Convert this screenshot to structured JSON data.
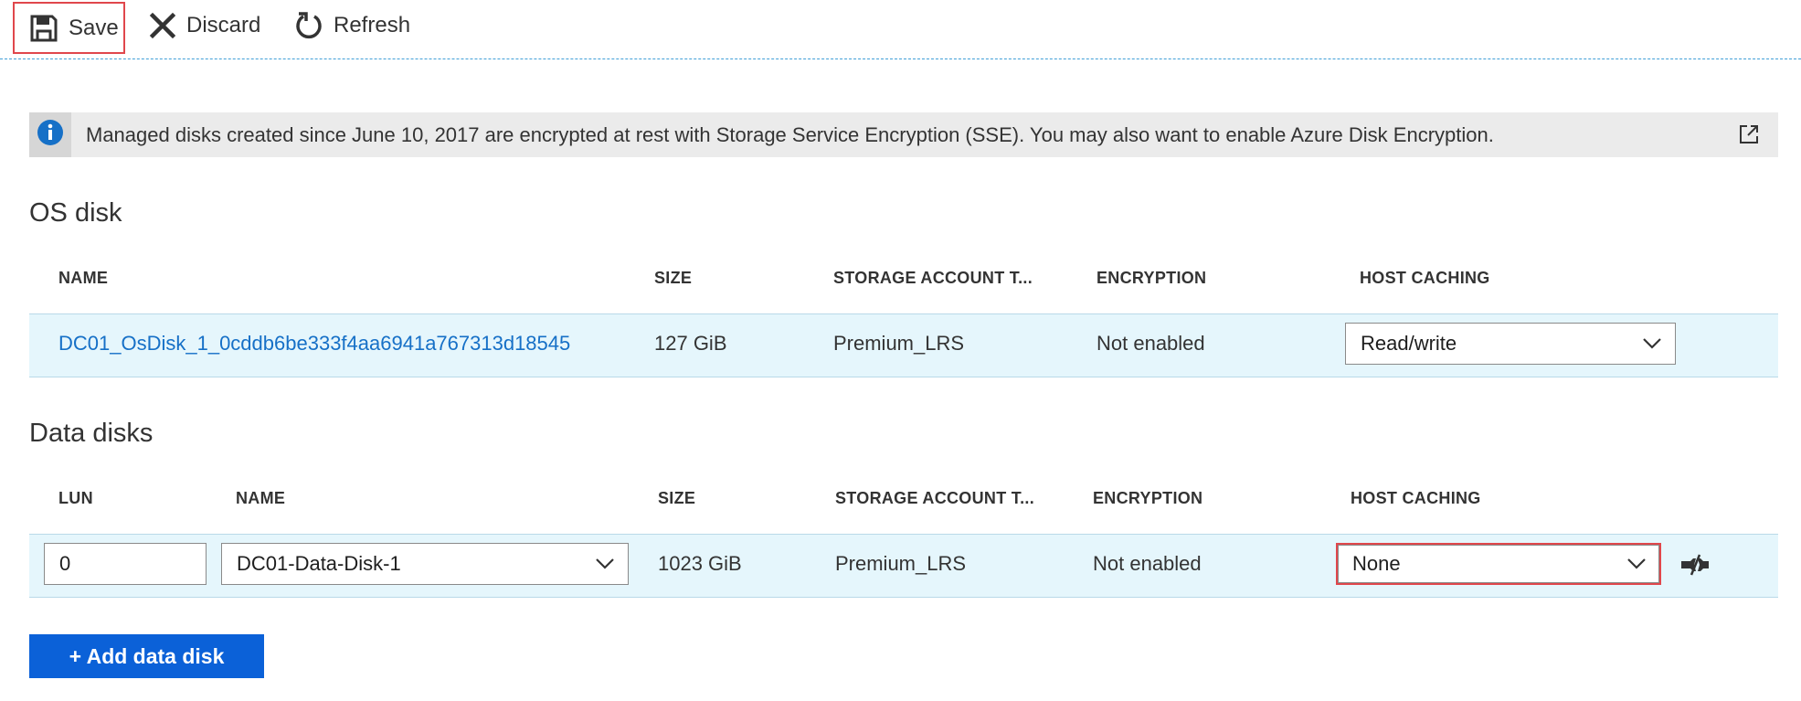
{
  "toolbar": {
    "save_label": "Save",
    "discard_label": "Discard",
    "refresh_label": "Refresh"
  },
  "banner": {
    "message": "Managed disks created since June 10, 2017 are encrypted at rest with Storage Service Encryption (SSE). You may also want to enable Azure Disk Encryption."
  },
  "os_disk": {
    "title": "OS disk",
    "headers": {
      "name": "NAME",
      "size": "SIZE",
      "storage": "STORAGE ACCOUNT T...",
      "encryption": "ENCRYPTION",
      "host_caching": "HOST CACHING"
    },
    "row": {
      "name": "DC01_OsDisk_1_0cddb6be333f4aa6941a767313d18545",
      "size": "127 GiB",
      "storage": "Premium_LRS",
      "encryption": "Not enabled",
      "host_caching": "Read/write"
    }
  },
  "data_disks": {
    "title": "Data disks",
    "headers": {
      "lun": "LUN",
      "name": "NAME",
      "size": "SIZE",
      "storage": "STORAGE ACCOUNT T...",
      "encryption": "ENCRYPTION",
      "host_caching": "HOST CACHING"
    },
    "rows": [
      {
        "lun": "0",
        "name": "DC01-Data-Disk-1",
        "size": "1023 GiB",
        "storage": "Premium_LRS",
        "encryption": "Not enabled",
        "host_caching": "None"
      }
    ]
  },
  "add_button": {
    "label": "+ Add data disk"
  },
  "icons": {
    "save": "save-icon",
    "discard": "close-icon",
    "refresh": "refresh-icon",
    "info": "info-icon",
    "external": "external-link-icon",
    "chevron": "chevron-down-icon",
    "detach": "detach-icon"
  },
  "colors": {
    "accent": "#0b61d8",
    "link": "#1670c7",
    "row_bg": "#e5f6fc",
    "highlight": "#e0474c"
  }
}
